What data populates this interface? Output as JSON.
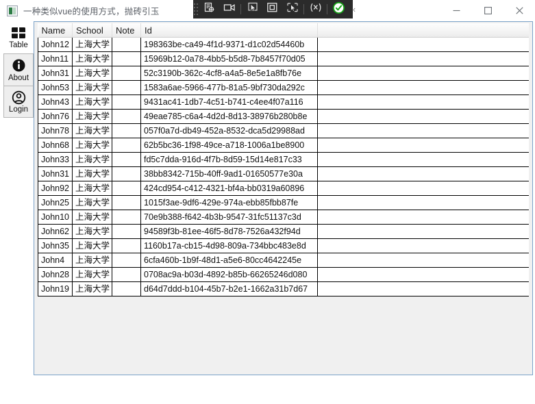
{
  "window": {
    "title": "一种类似vue的使用方式，抛砖引玉",
    "app_icon": "app-window-icon",
    "minimize_glyph": "—",
    "maximize_glyph": "□",
    "close_glyph": "✕"
  },
  "cu_toolbar": {
    "buttons": [
      {
        "name": "take-screenshot-icon",
        "label": "Take screenshot"
      },
      {
        "name": "record-video-icon",
        "label": "Record video"
      },
      {
        "name": "cursor-select-icon",
        "label": "Select element"
      },
      {
        "name": "region-select-icon",
        "label": "Select region"
      },
      {
        "name": "full-capture-icon",
        "label": "Capture window"
      },
      {
        "name": "annotate-icon",
        "label": "Annotate"
      },
      {
        "name": "confirm-check-icon",
        "label": "Confirm"
      }
    ],
    "collapse_glyph": "‹"
  },
  "sidebar": {
    "items": [
      {
        "label": "Table",
        "icon": "table-grid-icon",
        "selected": false,
        "framed": false
      },
      {
        "label": "About",
        "icon": "info-circle-icon",
        "selected": true,
        "framed": true
      },
      {
        "label": "Login",
        "icon": "user-circle-icon",
        "selected": false,
        "framed": true
      }
    ]
  },
  "table": {
    "columns": [
      "Name",
      "School",
      "Note",
      "Id",
      ""
    ],
    "rows": [
      {
        "name": "John12",
        "school": "上海大学",
        "note": "",
        "id": "198363be-ca49-4f1d-9371-d1c02d54460b",
        "extra": ""
      },
      {
        "name": "John11",
        "school": "上海大学",
        "note": "",
        "id": "15969b12-0a78-4bb5-b5d8-7b8457f70d05",
        "extra": ""
      },
      {
        "name": "John31",
        "school": "上海大学",
        "note": "",
        "id": "52c3190b-362c-4cf8-a4a5-8e5e1a8fb76e",
        "extra": ""
      },
      {
        "name": "John53",
        "school": "上海大学",
        "note": "",
        "id": "1583a6ae-5966-477b-81a5-9bf730da292c",
        "extra": ""
      },
      {
        "name": "John43",
        "school": "上海大学",
        "note": "",
        "id": "9431ac41-1db7-4c51-b741-c4ee4f07a116",
        "extra": ""
      },
      {
        "name": "John76",
        "school": "上海大学",
        "note": "",
        "id": "49eae785-c6a4-4d2d-8d13-38976b280b8e",
        "extra": ""
      },
      {
        "name": "John78",
        "school": "上海大学",
        "note": "",
        "id": "057f0a7d-db49-452a-8532-dca5d29988ad",
        "extra": ""
      },
      {
        "name": "John68",
        "school": "上海大学",
        "note": "",
        "id": "62b5bc36-1f98-49ce-a718-1006a1be8900",
        "extra": ""
      },
      {
        "name": "John33",
        "school": "上海大学",
        "note": "",
        "id": "fd5c7dda-916d-4f7b-8d59-15d14e817c33",
        "extra": ""
      },
      {
        "name": "John31",
        "school": "上海大学",
        "note": "",
        "id": "38bb8342-715b-40ff-9ad1-01650577e30a",
        "extra": ""
      },
      {
        "name": "John92",
        "school": "上海大学",
        "note": "",
        "id": "424cd954-c412-4321-bf4a-bb0319a60896",
        "extra": ""
      },
      {
        "name": "John25",
        "school": "上海大学",
        "note": "",
        "id": "1015f3ae-9df6-429e-974a-ebb85fbb87fe",
        "extra": ""
      },
      {
        "name": "John10",
        "school": "上海大学",
        "note": "",
        "id": "70e9b388-f642-4b3b-9547-31fc51137c3d",
        "extra": ""
      },
      {
        "name": "John62",
        "school": "上海大学",
        "note": "",
        "id": "94589f3b-81ee-46f5-8d78-7526a432f94d",
        "extra": ""
      },
      {
        "name": "John35",
        "school": "上海大学",
        "note": "",
        "id": "1160b17a-cb15-4d98-809a-734bbc483e8d",
        "extra": ""
      },
      {
        "name": "John4",
        "school": "上海大学",
        "note": "",
        "id": "6cfa460b-1b9f-48d1-a5e6-80cc4642245e",
        "extra": ""
      },
      {
        "name": "John28",
        "school": "上海大学",
        "note": "",
        "id": "0708ac9a-b03d-4892-b85b-66265246d080",
        "extra": ""
      },
      {
        "name": "John19",
        "school": "上海大学",
        "note": "",
        "id": "d64d7ddd-b104-45b7-b2e1-1662a31b7d67",
        "extra": ""
      }
    ]
  },
  "colors": {
    "panel_border": "#7aa2c8",
    "panel_bg": "#f0f0f0",
    "toolbar_bg": "#2b2b2b",
    "confirm_green": "#17a317",
    "title_text": "#5a5f66"
  }
}
